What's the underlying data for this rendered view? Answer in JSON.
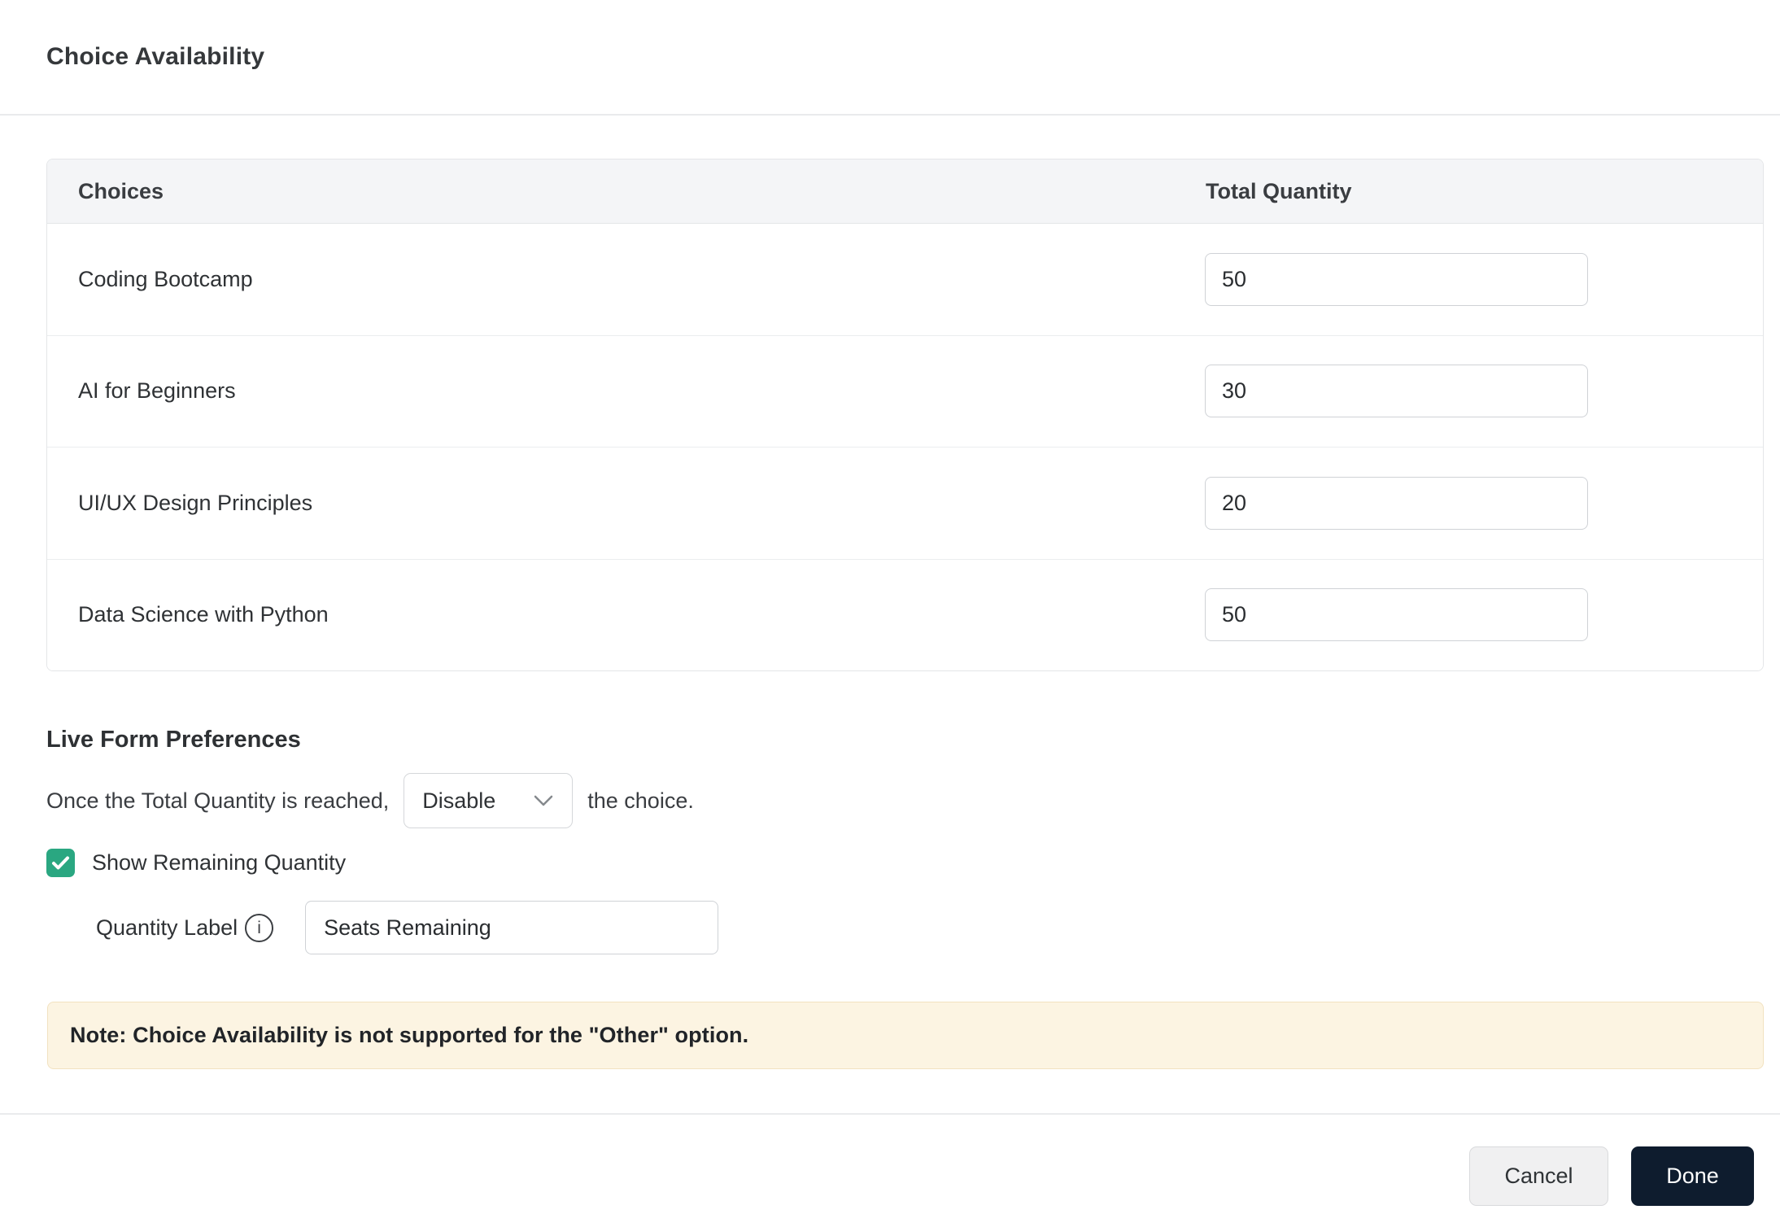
{
  "header": {
    "title": "Choice Availability"
  },
  "table": {
    "columns": {
      "choices": "Choices",
      "total_quantity": "Total Quantity"
    },
    "rows": [
      {
        "label": "Coding Bootcamp",
        "quantity": "50"
      },
      {
        "label": "AI for Beginners",
        "quantity": "30"
      },
      {
        "label": "UI/UX Design Principles",
        "quantity": "20"
      },
      {
        "label": "Data Science with Python",
        "quantity": "50"
      }
    ]
  },
  "preferences": {
    "heading": "Live Form Preferences",
    "sentence_prefix": "Once the Total Quantity is reached,",
    "dropdown_value": "Disable",
    "sentence_suffix": "the choice.",
    "checkbox": {
      "label": "Show Remaining Quantity",
      "checked": true
    },
    "quantity_label": {
      "label": "Quantity Label",
      "value": "Seats Remaining"
    }
  },
  "note": {
    "text": "Note: Choice Availability is not supported for the \"Other\" option."
  },
  "footer": {
    "cancel_label": "Cancel",
    "done_label": "Done"
  },
  "icons": {
    "info_glyph": "i",
    "chevron_down": "v",
    "checkmark": "check"
  },
  "colors": {
    "accent_green": "#2aa781",
    "done_button_bg": "#0e1c2e",
    "note_bg": "#fcf4e2",
    "table_header_bg": "#f4f5f7"
  }
}
